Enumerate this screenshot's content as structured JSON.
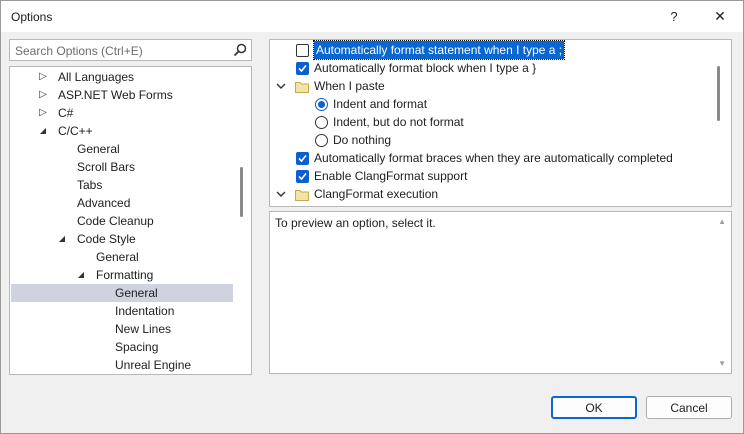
{
  "window": {
    "title": "Options",
    "help_glyph": "?",
    "close_glyph": "✕"
  },
  "search": {
    "placeholder": "Search Options (Ctrl+E)",
    "icon": "search-icon"
  },
  "tree": {
    "items": [
      {
        "label": "All Languages",
        "level": 0,
        "expander": "collapsed"
      },
      {
        "label": "ASP.NET Web Forms",
        "level": 0,
        "expander": "collapsed"
      },
      {
        "label": "C#",
        "level": 0,
        "expander": "collapsed"
      },
      {
        "label": "C/C++",
        "level": 0,
        "expander": "expanded"
      },
      {
        "label": "General",
        "level": 1,
        "expander": "none"
      },
      {
        "label": "Scroll Bars",
        "level": 1,
        "expander": "none"
      },
      {
        "label": "Tabs",
        "level": 1,
        "expander": "none"
      },
      {
        "label": "Advanced",
        "level": 1,
        "expander": "none"
      },
      {
        "label": "Code Cleanup",
        "level": 1,
        "expander": "none"
      },
      {
        "label": "Code Style",
        "level": 1,
        "expander": "expanded"
      },
      {
        "label": "General",
        "level": 2,
        "expander": "none"
      },
      {
        "label": "Formatting",
        "level": 2,
        "expander": "expanded"
      },
      {
        "label": "General",
        "level": 3,
        "expander": "none",
        "selected": true
      },
      {
        "label": "Indentation",
        "level": 3,
        "expander": "none"
      },
      {
        "label": "New Lines",
        "level": 3,
        "expander": "none"
      },
      {
        "label": "Spacing",
        "level": 3,
        "expander": "none"
      },
      {
        "label": "Unreal Engine",
        "level": 3,
        "expander": "none"
      }
    ]
  },
  "options": {
    "rows": [
      {
        "kind": "checkbox",
        "label": "Automatically format statement when I type a ;",
        "checked": false,
        "focused": true
      },
      {
        "kind": "checkbox",
        "label": "Automatically format block when I type a }",
        "checked": true
      },
      {
        "kind": "group",
        "label": "When I paste",
        "expanded": true
      },
      {
        "kind": "radio",
        "label": "Indent and format",
        "checked": true
      },
      {
        "kind": "radio",
        "label": "Indent, but do not format",
        "checked": false
      },
      {
        "kind": "radio",
        "label": "Do nothing",
        "checked": false
      },
      {
        "kind": "checkbox",
        "label": "Automatically format braces when they are automatically completed",
        "checked": true
      },
      {
        "kind": "checkbox",
        "label": "Enable ClangFormat support",
        "checked": true
      },
      {
        "kind": "group",
        "label": "ClangFormat execution",
        "expanded": true
      }
    ]
  },
  "description": {
    "text": "To preview an option, select it."
  },
  "buttons": {
    "ok": "OK",
    "cancel": "Cancel"
  },
  "colors": {
    "accent": "#0a5fd1",
    "selection": "#cfd3e0",
    "border": "#b8b8b8"
  }
}
